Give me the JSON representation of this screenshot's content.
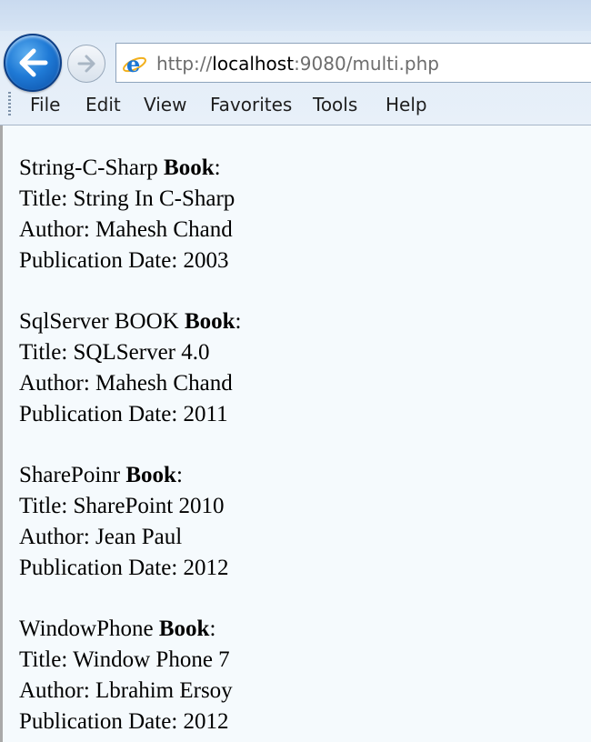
{
  "browser": {
    "address": {
      "protocol": "http://",
      "host": "localhost",
      "rest": ":9080/multi.php"
    },
    "menu": [
      "File",
      "Edit",
      "View",
      "Favorites",
      "Tools",
      "Help"
    ]
  },
  "page": {
    "books": [
      {
        "name": "String-C-Sharp",
        "label_suffix": "Book",
        "colon": ":",
        "title": "Title: String In C-Sharp",
        "author": "Author: Mahesh Chand",
        "date": "Publication Date: 2003"
      },
      {
        "name": "SqlServer BOOK",
        "label_suffix": "Book",
        "colon": ":",
        "title": "Title: SQLServer 4.0",
        "author": "Author: Mahesh Chand",
        "date": "Publication Date: 2011"
      },
      {
        "name": "SharePoinr",
        "label_suffix": "Book",
        "colon": ":",
        "title": "Title: SharePoint 2010",
        "author": "Author: Jean Paul",
        "date": "Publication Date: 2012"
      },
      {
        "name": "WindowPhone",
        "label_suffix": "Book",
        "colon": ":",
        "title": "Title: Window Phone 7",
        "author": "Author: Lbrahim Ersoy",
        "date": "Publication Date: 2012"
      }
    ]
  },
  "icons": {
    "back": "arrow-left",
    "forward": "arrow-right",
    "site": "internet-explorer-logo"
  }
}
